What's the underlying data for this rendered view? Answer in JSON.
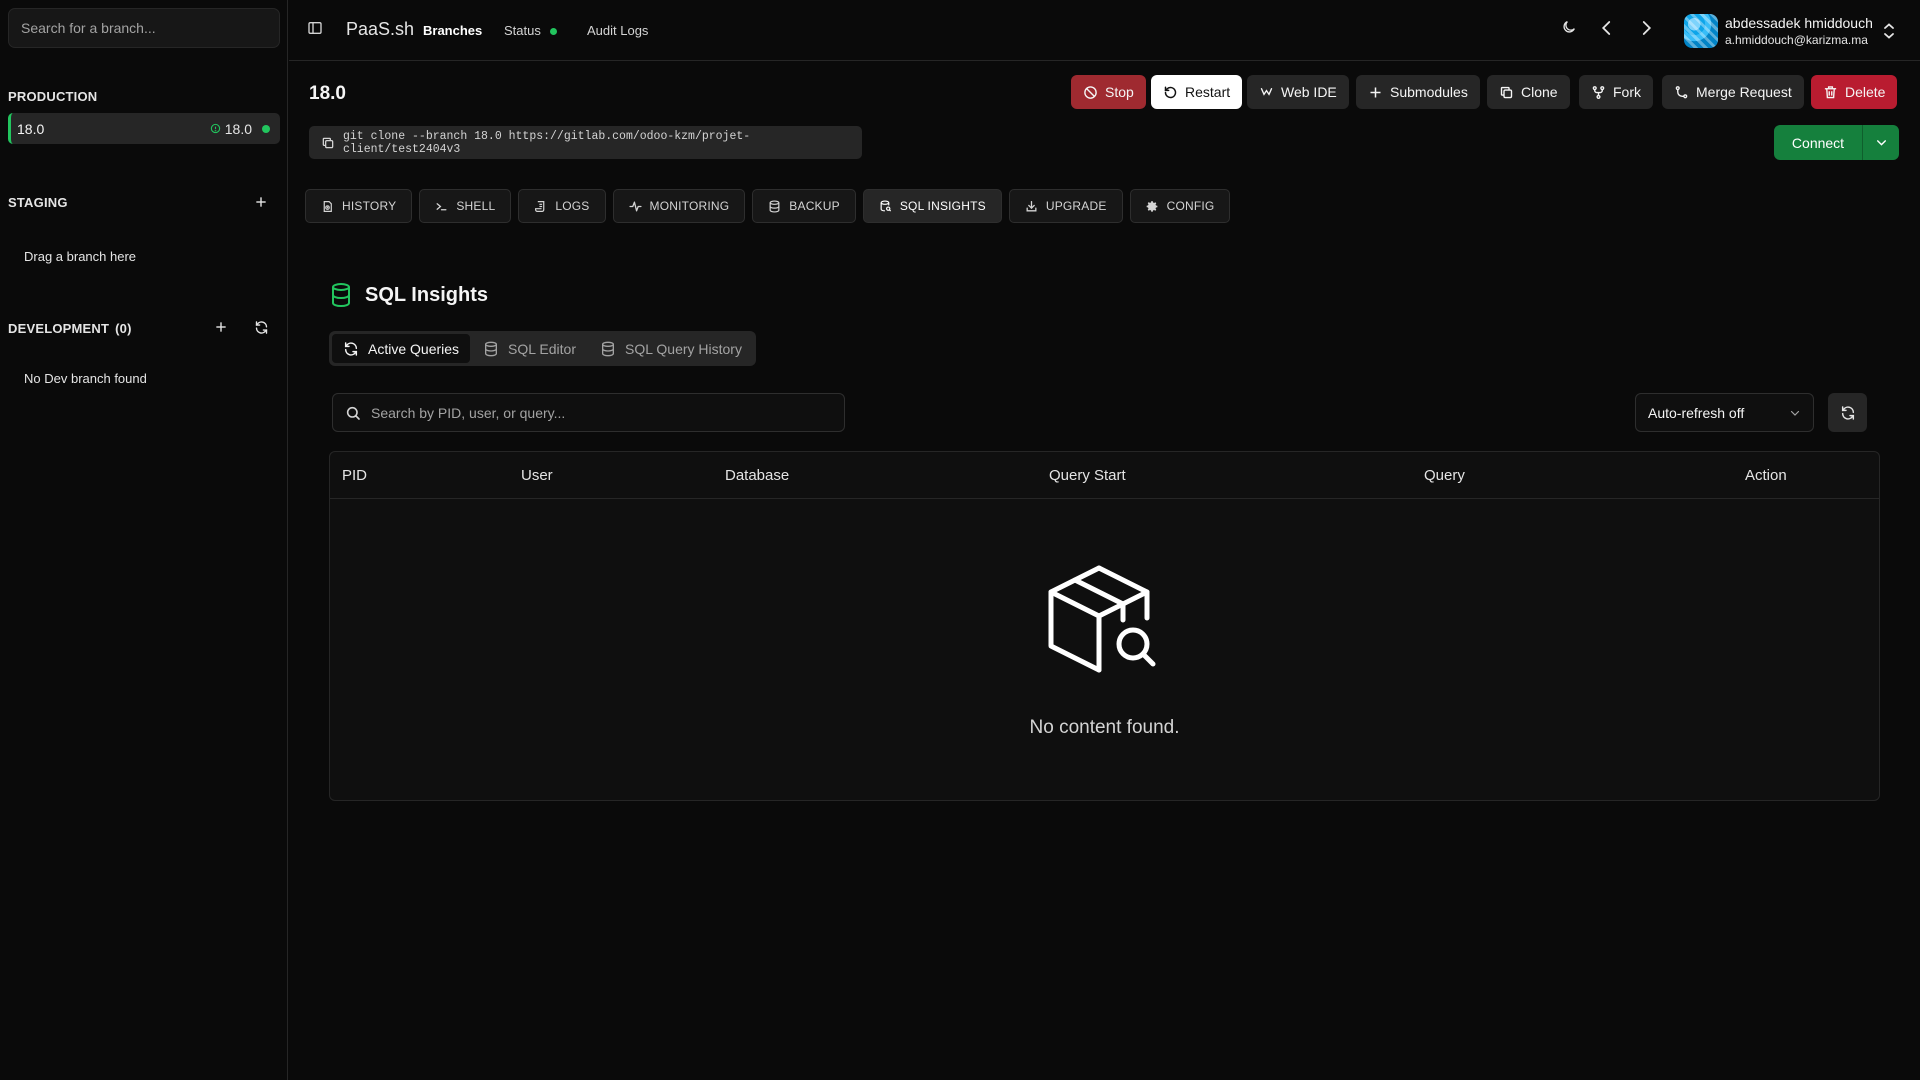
{
  "sidebar": {
    "search_placeholder": "Search for a branch...",
    "production": {
      "label": "PRODUCTION",
      "branch": {
        "name": "18.0",
        "version": "18.0",
        "status_color": "#22c55e"
      }
    },
    "staging": {
      "label": "STAGING",
      "hint": "Drag a branch here"
    },
    "development": {
      "label": "DEVELOPMENT",
      "count": "(0)",
      "hint": "No Dev branch found"
    }
  },
  "topbar": {
    "brand": "PaaS.sh",
    "nav": {
      "branches": "Branches",
      "status": "Status",
      "audit_logs": "Audit Logs"
    },
    "user": {
      "name": "abdessadek hmiddouch",
      "email": "a.hmiddouch@karizma.ma"
    }
  },
  "branch": {
    "title": "18.0",
    "actions": {
      "stop": "Stop",
      "restart": "Restart",
      "web_ide": "Web IDE",
      "submodules": "Submodules",
      "clone": "Clone",
      "fork": "Fork",
      "merge_request": "Merge Request",
      "delete": "Delete"
    },
    "clone_command": "git clone --branch 18.0 https://gitlab.com/odoo-kzm/projet-client/test2404v3",
    "connect": "Connect"
  },
  "tabs": {
    "history": "HISTORY",
    "shell": "SHELL",
    "logs": "LOGS",
    "monitoring": "MONITORING",
    "backup": "BACKUP",
    "sql_insights": "SQL INSIGHTS",
    "upgrade": "UPGRADE",
    "config": "CONFIG"
  },
  "sql": {
    "title": "SQL Insights",
    "subtabs": {
      "active_queries": "Active Queries",
      "sql_editor": "SQL Editor",
      "history": "SQL Query History"
    },
    "search_placeholder": "Search by PID, user, or query...",
    "auto_refresh": "Auto-refresh off",
    "columns": {
      "pid": "PID",
      "user": "User",
      "database": "Database",
      "query_start": "Query Start",
      "query": "Query",
      "action": "Action"
    },
    "empty_text": "No content found."
  },
  "colors": {
    "accent": "#22c55e",
    "stop": "#9f2a30",
    "delete": "#b91c30",
    "connect": "#15803d"
  }
}
